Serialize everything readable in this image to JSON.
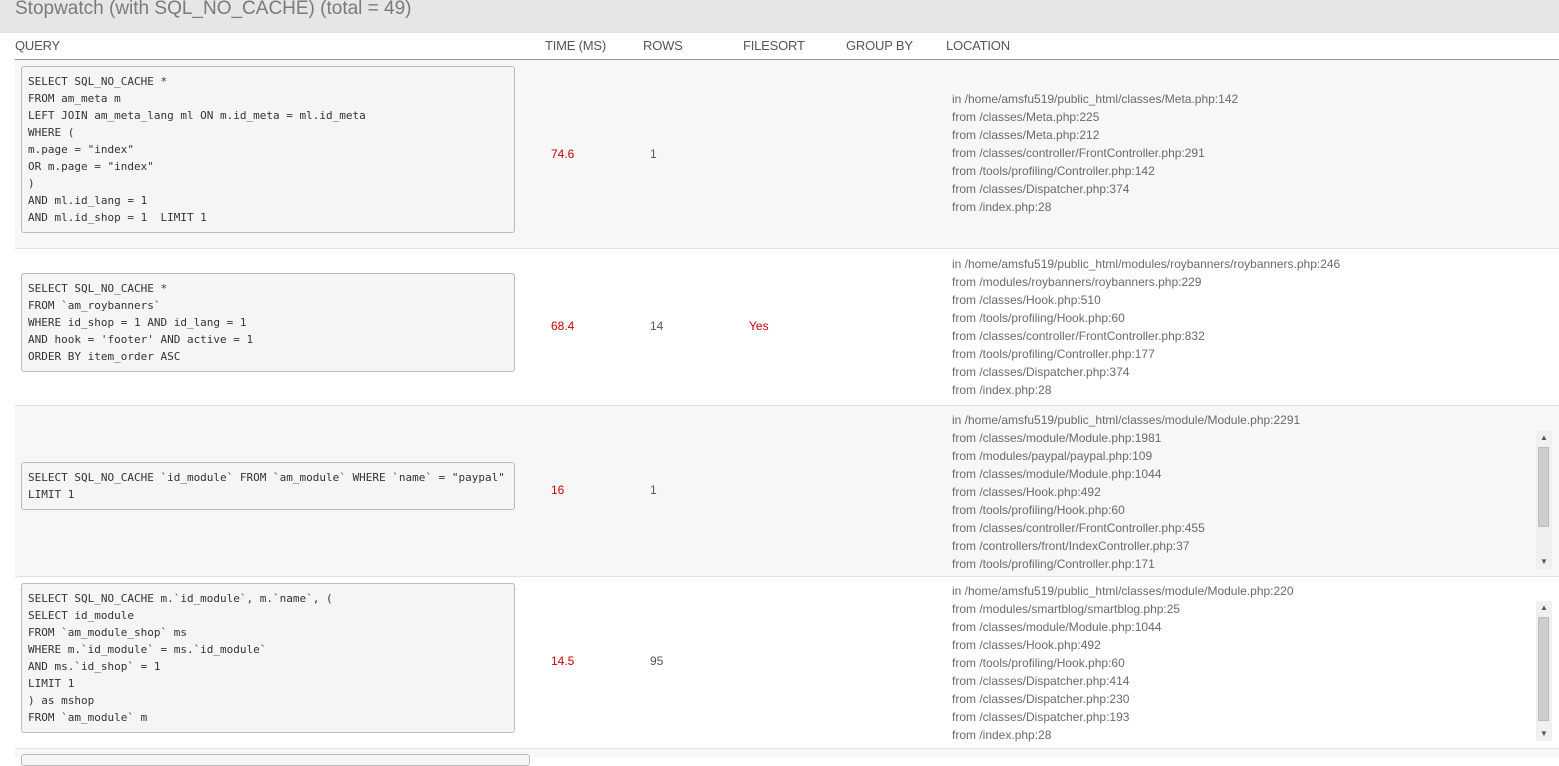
{
  "panel": {
    "title": "Stopwatch (with SQL_NO_CACHE) (total = 49)"
  },
  "columns": {
    "query": "QUERY",
    "time": "TIME (MS)",
    "rows": "ROWS",
    "filesort": "FILESORT",
    "group_by": "GROUP BY",
    "location": "LOCATION"
  },
  "rows": [
    {
      "query": "SELECT SQL_NO_CACHE *\nFROM am_meta m\nLEFT JOIN am_meta_lang ml ON m.id_meta = ml.id_meta\nWHERE (\nm.page = \"index\"\nOR m.page = \"index\"\n)\nAND ml.id_lang = 1\nAND ml.id_shop = 1  LIMIT 1",
      "time": "74.6",
      "rows": "1",
      "filesort": "",
      "group_by": "",
      "location": [
        "in /home/amsfu519/public_html/classes/Meta.php:142",
        "from /classes/Meta.php:225",
        "from /classes/Meta.php:212",
        "from /classes/controller/FrontController.php:291",
        "from /tools/profiling/Controller.php:142",
        "from /classes/Dispatcher.php:374",
        "from /index.php:28"
      ]
    },
    {
      "query": "SELECT SQL_NO_CACHE *\nFROM `am_roybanners`\nWHERE id_shop = 1 AND id_lang = 1\nAND hook = 'footer' AND active = 1\nORDER BY item_order ASC",
      "time": "68.4",
      "rows": "14",
      "filesort": "Yes",
      "group_by": "",
      "location": [
        "in /home/amsfu519/public_html/modules/roybanners/roybanners.php:246",
        "from /modules/roybanners/roybanners.php:229",
        "from /classes/Hook.php:510",
        "from /tools/profiling/Hook.php:60",
        "from /classes/controller/FrontController.php:832",
        "from /tools/profiling/Controller.php:177",
        "from /classes/Dispatcher.php:374",
        "from /index.php:28"
      ]
    },
    {
      "query": "SELECT SQL_NO_CACHE `id_module` FROM `am_module` WHERE `name` = \"paypal\" LIMIT 1",
      "time": "16",
      "rows": "1",
      "filesort": "",
      "group_by": "",
      "location": [
        "in /home/amsfu519/public_html/classes/module/Module.php:2291",
        "from /classes/module/Module.php:1981",
        "from /modules/paypal/paypal.php:109",
        "from /classes/module/Module.php:1044",
        "from /classes/Hook.php:492",
        "from /tools/profiling/Hook.php:60",
        "from /classes/controller/FrontController.php:455",
        "from /controllers/front/IndexController.php:37",
        "from /tools/profiling/Controller.php:171"
      ]
    },
    {
      "query": "SELECT SQL_NO_CACHE m.`id_module`, m.`name`, (\nSELECT id_module\nFROM `am_module_shop` ms\nWHERE m.`id_module` = ms.`id_module`\nAND ms.`id_shop` = 1\nLIMIT 1\n) as mshop\nFROM `am_module` m",
      "time": "14.5",
      "rows": "95",
      "filesort": "",
      "group_by": "",
      "location": [
        "in /home/amsfu519/public_html/classes/module/Module.php:220",
        "from /modules/smartblog/smartblog.php:25",
        "from /classes/module/Module.php:1044",
        "from /classes/Hook.php:492",
        "from /tools/profiling/Hook.php:60",
        "from /classes/Dispatcher.php:414",
        "from /classes/Dispatcher.php:230",
        "from /classes/Dispatcher.php:193",
        "from /index.php:28"
      ]
    }
  ],
  "icons": {
    "scroll_up": "scroll-up-arrow-icon",
    "scroll_down": "scroll-down-arrow-icon"
  }
}
